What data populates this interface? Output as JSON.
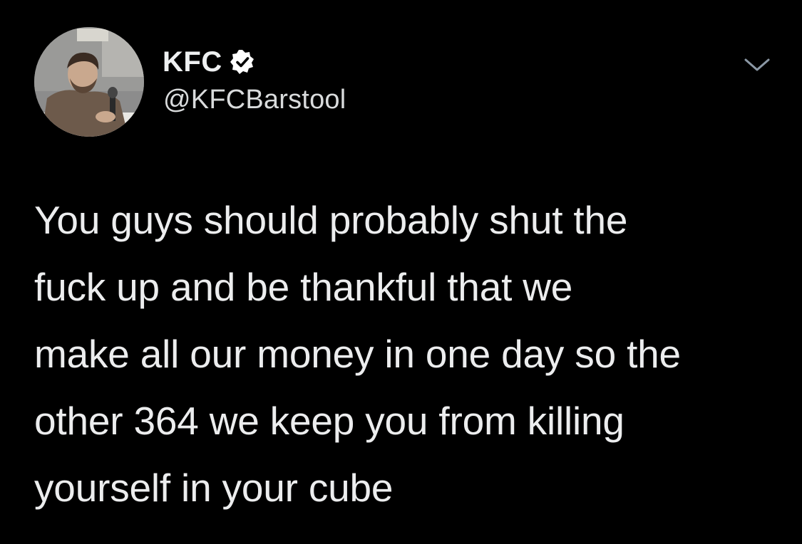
{
  "tweet": {
    "display_name": "KFC",
    "handle": "@KFCBarstool",
    "verified": true,
    "text": "You guys should probably shut the\nfuck up and be thankful that we\nmake all our money in one day so the\nother 364 we keep you from killing\nyourself in your cube"
  },
  "icons": {
    "verified": "verified-badge-icon",
    "menu": "chevron-down-icon"
  },
  "colors": {
    "background": "#000000",
    "text": "#ecedee",
    "handle": "#d9dbdc",
    "chevron": "#8b98a5"
  }
}
